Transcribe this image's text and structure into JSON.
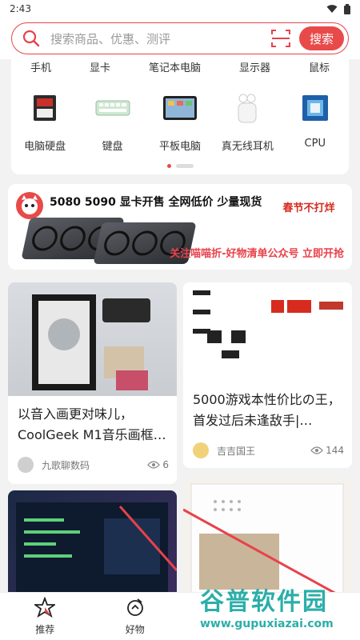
{
  "status": {
    "time": "2:43"
  },
  "search": {
    "placeholder": "搜索商品、优惠、测评",
    "button": "搜索"
  },
  "categories_row1": [
    "手机",
    "显卡",
    "笔记本电脑",
    "显示器",
    "鼠标"
  ],
  "categories_row2": [
    {
      "label": "电脑硬盘",
      "icon": "hard-drive-icon"
    },
    {
      "label": "键盘",
      "icon": "keyboard-icon"
    },
    {
      "label": "平板电脑",
      "icon": "tablet-icon"
    },
    {
      "label": "真无线耳机",
      "icon": "earbuds-icon"
    },
    {
      "label": "CPU",
      "icon": "cpu-icon"
    }
  ],
  "banner": {
    "title": "5080 5090 显卡开售  全网低价 少量现货",
    "subtitle": "关注喵喵折-好物清单公众号 立即开抢",
    "stamp": "春节不打烊"
  },
  "feed": [
    {
      "title": "以音入画更对味儿，CoolGeek M1音乐画框…",
      "author": "九歌聊数码",
      "views": "6"
    },
    {
      "title": "5000游戏本性价比の王，首发过后未逢敌手|…",
      "author": "吉吉国王",
      "views": "144"
    }
  ],
  "nav": [
    {
      "label": "推荐",
      "icon": "star-icon"
    },
    {
      "label": "好物",
      "icon": "tag-icon"
    }
  ],
  "watermark": {
    "text": "谷普软件园",
    "url": "www.gupuxiazai.com"
  },
  "colors": {
    "accent": "#e84a4a"
  }
}
